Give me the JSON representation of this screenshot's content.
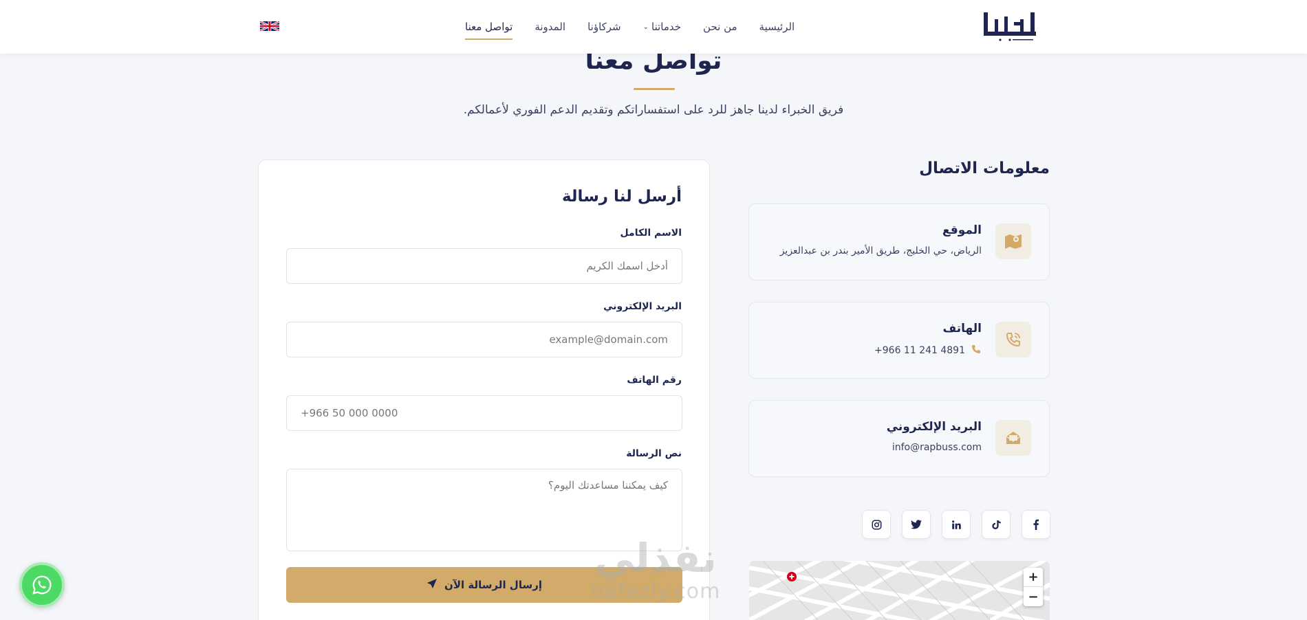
{
  "header": {
    "logo_text": "الابتشر",
    "nav": [
      {
        "label": "الرئيسية"
      },
      {
        "label": "من نحن"
      },
      {
        "label": "خدماتنا"
      },
      {
        "label": "شركاؤنا"
      },
      {
        "label": "المدونة"
      },
      {
        "label": "تواصل معنا"
      }
    ],
    "language_flag": "uk-flag-icon"
  },
  "hero": {
    "title": "تواصل معنا",
    "subtitle": "فريق الخبراء لدينا جاهز للرد على استفساراتكم وتقديم الدعم الفوري لأعمالكم."
  },
  "contact_info": {
    "title": "معلومات الاتصال",
    "location_title": "الموقع",
    "location_value": "الرياض، حي الخليج، طريق الأمير بندر بن عبدالعزيز",
    "phone_title": "الهاتف",
    "phone_value": "+966 11 241 4891",
    "email_title": "البريد الإلكتروني",
    "email_value": "info@rapbuss.com",
    "socials": [
      "facebook-icon",
      "tiktok-icon",
      "linkedin-icon",
      "twitter-icon",
      "instagram-icon"
    ]
  },
  "form": {
    "title": "أرسل لنا رسالة",
    "name_label": "الاسم الكامل",
    "name_placeholder": "أدخل اسمك الكريم",
    "email_label": "البريد الإلكتروني",
    "email_placeholder": "example@domain.com",
    "phone_label": "رقم الهاتف",
    "phone_placeholder": "+966 50 000 0000",
    "message_label": "نص الرسالة",
    "message_placeholder": "كيف يمكننا مساعدتك اليوم؟",
    "submit_label": "إرسال الرسالة الآن"
  },
  "watermark": {
    "arabic": "نفذلي",
    "latin": "nafezly.com"
  },
  "colors": {
    "accent": "#d2a965",
    "navy": "#1e2650",
    "whatsapp": "#4cd964"
  }
}
